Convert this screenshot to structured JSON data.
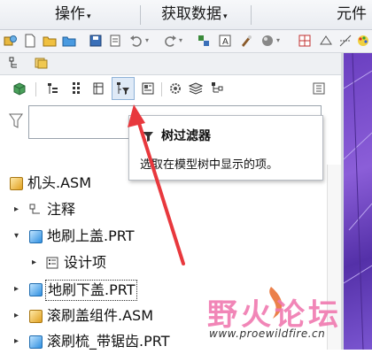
{
  "menubar": {
    "items": [
      {
        "label": "操作"
      },
      {
        "label": "获取数据"
      },
      {
        "label": "元件"
      }
    ]
  },
  "tooltip": {
    "title": "树过滤器",
    "description": "选取在模型树中显示的项。"
  },
  "filter": {
    "placeholder": ""
  },
  "tree": {
    "items": [
      {
        "label": "机头.ASM",
        "icon": "assembly-icon",
        "expander": ""
      },
      {
        "label": "注释",
        "icon": "annotation-icon",
        "expander": "collapsed"
      },
      {
        "label": "地刷上盖.PRT",
        "icon": "part-icon",
        "expander": "expanded"
      },
      {
        "label": "设计项",
        "icon": "design-items-icon",
        "expander": "collapsed"
      },
      {
        "label": "地刷下盖.PRT",
        "icon": "part-icon",
        "expander": "collapsed"
      },
      {
        "label": "滚刷盖组件.ASM",
        "icon": "assembly-icon",
        "expander": "collapsed"
      },
      {
        "label": "滚刷梳_带锯齿.PRT",
        "icon": "part-icon",
        "expander": "collapsed"
      }
    ]
  },
  "watermark": {
    "brand": "野火论坛",
    "url": "www.proewildfire.cn"
  },
  "colors": {
    "arrow": "#e8383d",
    "viewport": "#7a55d0",
    "accent_blue": "#2f8fe0"
  }
}
